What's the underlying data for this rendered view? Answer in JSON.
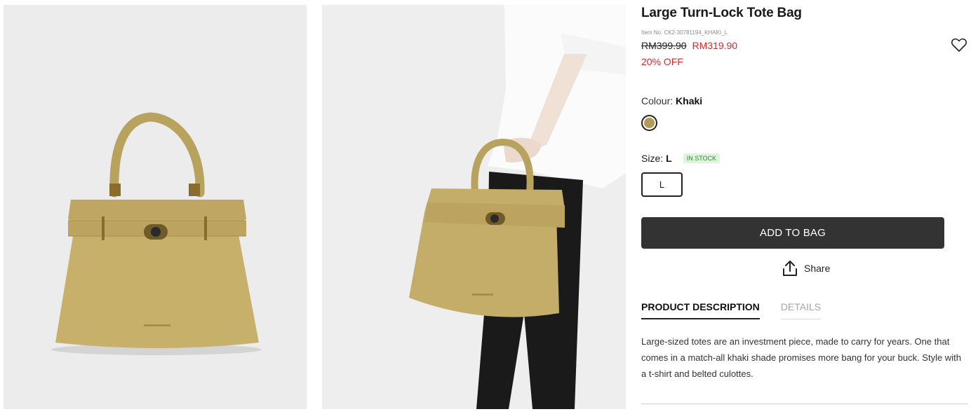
{
  "product": {
    "title": "Large Turn-Lock Tote Bag",
    "item_no": "Item No. CK2-30781194_KHAKI_L",
    "price_original": "RM399.90",
    "price_sale": "RM319.90",
    "discount": "20% OFF"
  },
  "images": [
    {
      "icon": "product-photo-khaki-tote"
    },
    {
      "icon": "model-holding-khaki-tote"
    }
  ],
  "colour": {
    "label": "Colour:",
    "value": "Khaki",
    "swatch_color": "#b39a5a"
  },
  "size": {
    "label": "Size:",
    "value": "L",
    "stock": "IN STOCK",
    "options": [
      "L"
    ]
  },
  "actions": {
    "add_to_bag": "ADD TO BAG",
    "share": "Share"
  },
  "tabs": [
    {
      "label": "PRODUCT DESCRIPTION",
      "active": true
    },
    {
      "label": "DETAILS",
      "active": false
    }
  ],
  "description": "Large-sized totes are an investment piece, made to carry for years. One that comes in a match-all khaki shade promises more bang for your buck. Style with a t-shirt and belted culottes.",
  "colors": {
    "sale": "#d42a2a",
    "button": "#333333",
    "stock_bg": "#dff3df",
    "stock_text": "#2f8a2f"
  }
}
